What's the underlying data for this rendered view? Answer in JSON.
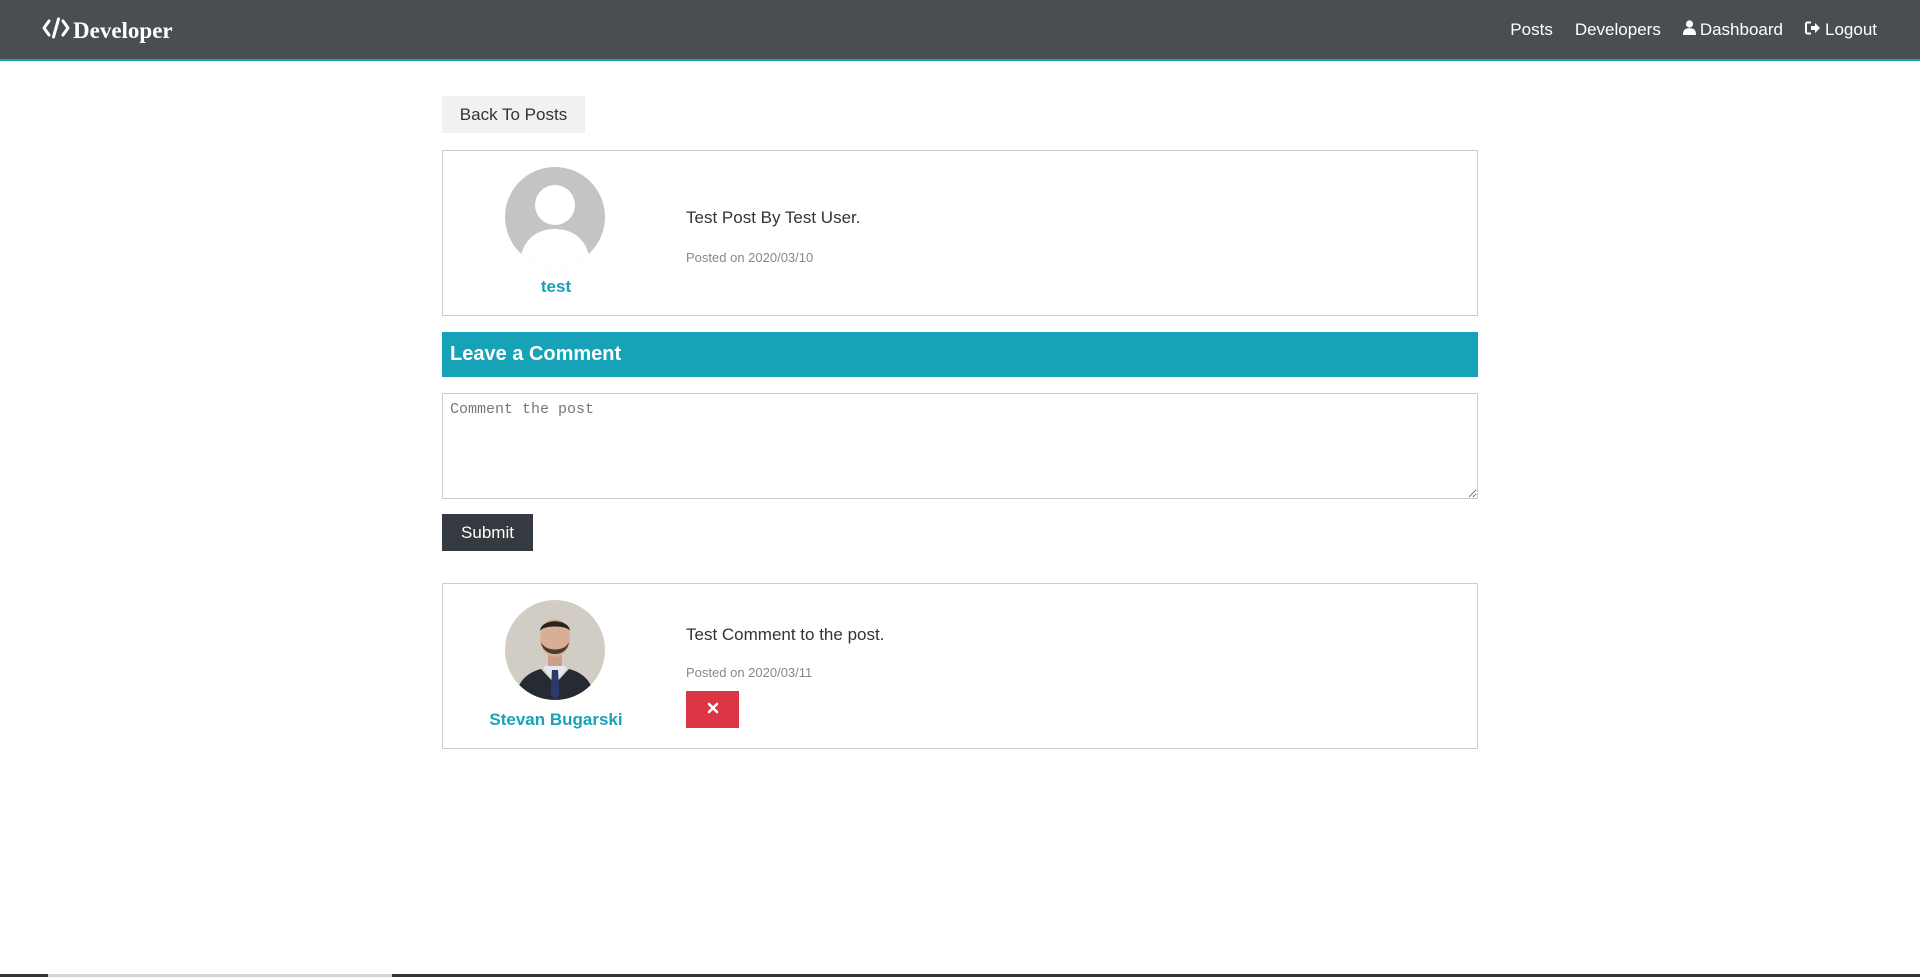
{
  "navbar": {
    "brand": "Developer",
    "brand_icon": "code-icon",
    "links": [
      {
        "label": "Posts",
        "icon": null
      },
      {
        "label": "Developers",
        "icon": null
      },
      {
        "label": "Dashboard",
        "icon": "user-icon"
      },
      {
        "label": "Logout",
        "icon": "sign-out-icon"
      }
    ]
  },
  "back_button": {
    "label": "Back To Posts"
  },
  "post": {
    "author": "test",
    "text": "Test Post By Test User.",
    "posted": "Posted on 2020/03/10",
    "avatar": "default-avatar-icon"
  },
  "comment_form": {
    "header": "Leave a Comment",
    "placeholder": "Comment the post",
    "value": "",
    "submit_label": "Submit"
  },
  "comments": [
    {
      "author": "Stevan Bugarski",
      "text": "Test Comment to the post.",
      "posted": "Posted on 2020/03/11",
      "avatar": "user-photo",
      "delete_icon": "times-icon"
    }
  ],
  "colors": {
    "navbar_bg": "#4a4e53",
    "accent": "#17a2b8",
    "danger": "#dc3545",
    "dark": "#343a40",
    "light_btn": "#f1f1f1",
    "muted_text": "#888888"
  }
}
